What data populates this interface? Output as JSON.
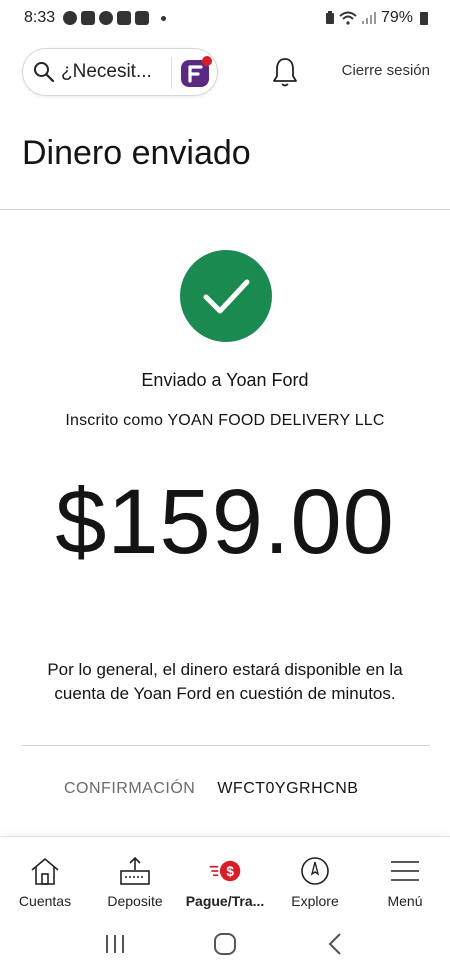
{
  "status_bar": {
    "time": "8:33",
    "battery": "79%"
  },
  "header": {
    "search_placeholder": "¿Necesit...",
    "logout_label": "Cierre sesión"
  },
  "page": {
    "title": "Dinero enviado"
  },
  "confirmation": {
    "sent_to": "Enviado a Yoan Ford",
    "enrolled_as": "Inscrito como YOAN FOOD DELIVERY LLC",
    "amount": "$159.00",
    "availability_note": "Por lo general, el dinero estará disponible en la cuenta de Yoan Ford en cuestión de minutos.",
    "code_label": "CONFIRMACIÓN",
    "code_value": "WFCT0YGRHCNB"
  },
  "bottom_nav": {
    "items": [
      {
        "label": "Cuentas",
        "icon": "house-icon"
      },
      {
        "label": "Deposite",
        "icon": "deposit-icon"
      },
      {
        "label": "Pague/Tra...",
        "icon": "pay-transfer-icon",
        "active": true
      },
      {
        "label": "Explore",
        "icon": "compass-icon"
      },
      {
        "label": "Menú",
        "icon": "hamburger-menu-icon"
      }
    ]
  },
  "colors": {
    "success_green": "#1b8a50",
    "accent_red": "#d71e28",
    "assistant_purple": "#5a2a82"
  }
}
